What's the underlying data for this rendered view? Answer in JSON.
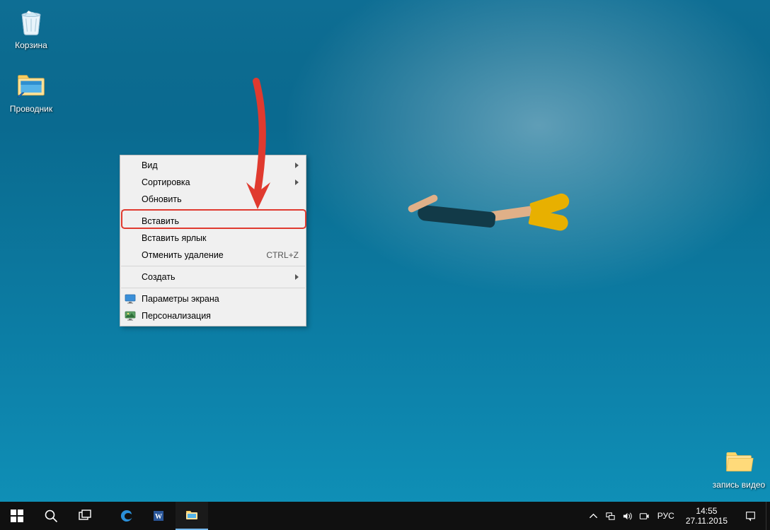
{
  "desktop_icons": {
    "recycle_bin": "Корзина",
    "file_explorer": "Проводник",
    "video_folder": "запись видео"
  },
  "context_menu": {
    "view": "Вид",
    "sort": "Сортировка",
    "refresh": "Обновить",
    "paste": "Вставить",
    "paste_shortcut": "Вставить ярлык",
    "undo_delete": "Отменить удаление",
    "undo_delete_key": "CTRL+Z",
    "new": "Создать",
    "display_settings": "Параметры экрана",
    "personalize": "Персонализация"
  },
  "tray": {
    "language": "РУС",
    "time": "14:55",
    "date": "27.11.2015"
  }
}
